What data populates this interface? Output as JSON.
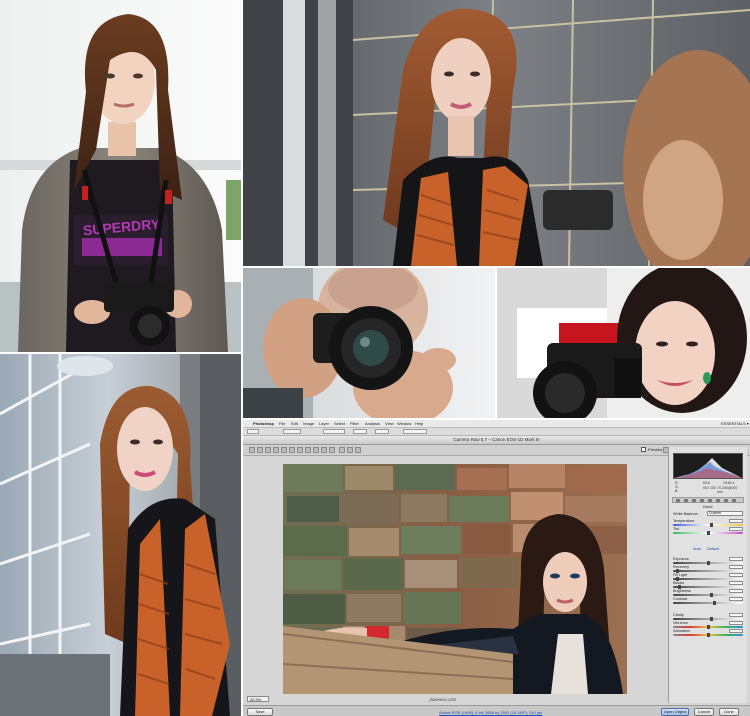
{
  "collage": {
    "tiles": [
      {
        "id": "girl-camera",
        "description_icon": "portrait-photo"
      },
      {
        "id": "woman-wall",
        "description_icon": "portrait-photo"
      },
      {
        "id": "man-camera",
        "description_icon": "camera-photo"
      },
      {
        "id": "asian-woman-camera",
        "description_icon": "camera-photo"
      },
      {
        "id": "woman-building",
        "description_icon": "portrait-photo"
      }
    ],
    "shirt_text": "SUPERDRY"
  },
  "app": {
    "menu": [
      "Photoshop",
      "File",
      "Edit",
      "Image",
      "Layer",
      "Select",
      "Filter",
      "Analysis",
      "View",
      "Window",
      "Help"
    ],
    "workspace": "ESSENTIALS ▾",
    "window_title": "Camera Raw 5.7  –  Canon EOS-1D Mark III",
    "preview_label": "Preview",
    "zoom": "32.9%",
    "filename": "_B2M9011.CR2",
    "workflow_link": "Adobe RGB (1998); 8 bit; 3888 by 2592 (10.1MP); 240 ppi",
    "buttons": {
      "save": "Save Image...",
      "open": "Open Object",
      "cancel": "Cancel",
      "done": "Done"
    }
  },
  "panel": {
    "readout": {
      "r": "R:",
      "g": "G:",
      "b": "B:",
      "f": "f/5.6",
      "shutter": "1/160 s",
      "iso": "ISO 100",
      "lens": "70-200@200 mm"
    },
    "section": "Basic",
    "white_balance_label": "White Balance:",
    "white_balance_value": "Custom",
    "auto": "Auto",
    "default": "Default",
    "rows": [
      {
        "label": "Temperature",
        "gradient": "temp"
      },
      {
        "label": "Tint",
        "gradient": "tint"
      },
      {
        "label": "Exposure",
        "gradient": "gray"
      },
      {
        "label": "Recovery",
        "gradient": "gray"
      },
      {
        "label": "Fill Light",
        "gradient": "gray"
      },
      {
        "label": "Blacks",
        "gradient": "gray"
      },
      {
        "label": "Brightness",
        "gradient": "gray"
      },
      {
        "label": "Contrast",
        "gradient": "gray"
      },
      {
        "label": "Clarity",
        "gradient": "gray"
      },
      {
        "label": "Vibrance",
        "gradient": "sat"
      },
      {
        "label": "Saturation",
        "gradient": "sat"
      }
    ]
  },
  "colors": {
    "accent": "#1d4fb0",
    "shirt_purple": "#a02aa0",
    "vest_orange": "#c9622a",
    "scarf_red": "#d3282c"
  }
}
